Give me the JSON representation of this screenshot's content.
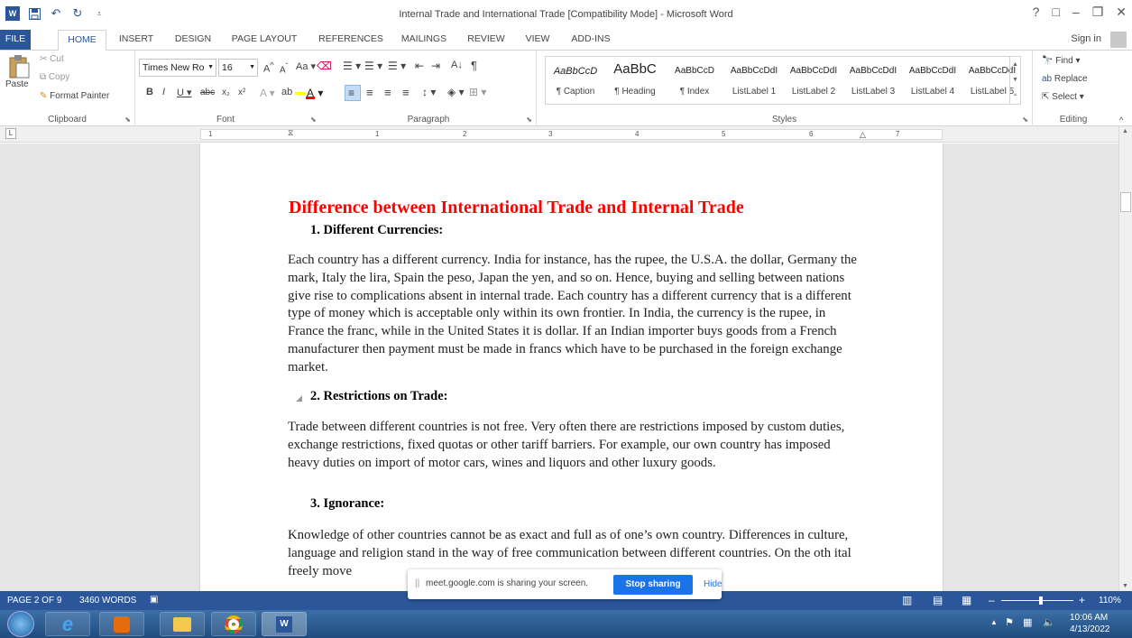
{
  "window": {
    "title": "Internal Trade and International Trade [Compatibility Mode] - Microsoft Word",
    "controls": [
      "?",
      "□",
      "–",
      "❐",
      "✕"
    ]
  },
  "qat": {
    "logo": "W",
    "save_icon": "save-icon",
    "undo_icon": "undo-icon",
    "redo_icon": "redo-icon"
  },
  "tabs": [
    "FILE",
    "HOME",
    "INSERT",
    "DESIGN",
    "PAGE LAYOUT",
    "REFERENCES",
    "MAILINGS",
    "REVIEW",
    "VIEW",
    "ADD-INS"
  ],
  "signin": "Sign in",
  "ribbon": {
    "clipboard": {
      "label": "Clipboard",
      "paste": "Paste",
      "cut": "Cut",
      "copy": "Copy",
      "format_painter": "Format Painter"
    },
    "font": {
      "label": "Font",
      "font_name": "Times New Ro",
      "font_size": "16"
    },
    "paragraph": {
      "label": "Paragraph"
    },
    "styles": {
      "label": "Styles",
      "items": [
        {
          "sample": "AaBbCcD",
          "name": "¶ Caption"
        },
        {
          "sample": "AaBbC",
          "name": "¶ Heading"
        },
        {
          "sample": "AaBbCcD",
          "name": "¶ Index"
        },
        {
          "sample": "AaBbCcDdI",
          "name": "ListLabel 1"
        },
        {
          "sample": "AaBbCcDdI",
          "name": "ListLabel 2"
        },
        {
          "sample": "AaBbCcDdI",
          "name": "ListLabel 3"
        },
        {
          "sample": "AaBbCcDdI",
          "name": "ListLabel 4"
        },
        {
          "sample": "AaBbCcDdI",
          "name": "ListLabel 5"
        }
      ]
    },
    "editing": {
      "label": "Editing",
      "find": "Find",
      "replace": "Replace",
      "select": "Select"
    }
  },
  "ruler": {
    "numbers": [
      "1",
      "1",
      "2",
      "3",
      "4",
      "5",
      "6",
      "7"
    ]
  },
  "document": {
    "title": "Difference between International Trade and Internal Trade",
    "sections": [
      {
        "heading": "1.  Different Currencies:",
        "body": "Each country has a different currency. India for instance, has the rupee, the U.S.A. the dollar, Germany the mark, Italy the lira, Spain the peso, Japan the yen, and so on. Hence, buying and selling between nations give rise to complications absent in internal trade. Each country has a different currency that is a different type of money which is acceptable only within its own frontier. In India, the currency is the rupee, in France the franc, while in the United States it is dollar. If an Indian importer buys goods from a French manufacturer then payment must be made in francs which have to be purchased in the foreign exchange market."
      },
      {
        "heading": "2.  Restrictions on Trade:",
        "body": "Trade between different countries is not free. Very often there are restrictions imposed by custom duties, exchange restrictions, fixed quotas or other tariff barriers. For example, our own country has imposed heavy duties on import of motor cars, wines and liquors and other luxury goods."
      },
      {
        "heading": "3.  Ignorance:",
        "body": "Knowledge of other countries cannot be as exact and full as of one’s own country. Differences in culture, language and religion stand in the way of free communication between different countries. On the oth                                                      ital freely move"
      }
    ]
  },
  "share_bar": {
    "text": "meet.google.com is sharing your screen.",
    "stop": "Stop sharing",
    "hide": "Hide"
  },
  "status": {
    "page": "PAGE 2 OF 9",
    "words": "3460 WORDS",
    "zoom": "110%"
  },
  "taskbar": {
    "time": "10:06 AM",
    "date": "4/13/2022"
  }
}
